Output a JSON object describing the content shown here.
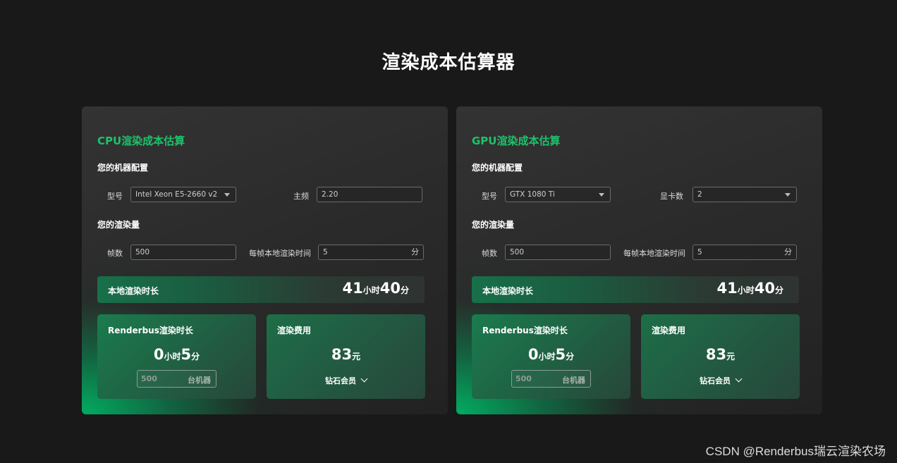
{
  "page": {
    "title": "渲染成本估算器"
  },
  "cards": [
    {
      "title": "CPU渲染成本估算",
      "machine_section": "您的机器配置",
      "field1_label": "型号",
      "field1_value": "Intel Xeon E5-2660 v2",
      "field2_label": "主频",
      "field2_value": "2.20",
      "render_section": "您的渲染量",
      "frames_label": "帧数",
      "frames_value": "500",
      "per_frame_label": "每帧本地渲染时间",
      "per_frame_value": "5",
      "per_frame_unit": "分",
      "local": {
        "label": "本地渲染时长",
        "hours": "41",
        "hours_unit": "小时",
        "minutes": "40",
        "minutes_unit": "分"
      },
      "renderbus": {
        "label": "Renderbus渲染时长",
        "hours": "0",
        "hours_unit": "小时",
        "minutes": "5",
        "minutes_unit": "分",
        "machines": "500",
        "machines_unit": "台机器"
      },
      "fee": {
        "label": "渲染费用",
        "amount": "83",
        "amount_unit": "元",
        "member": "钻石会员"
      }
    },
    {
      "title": "GPU渲染成本估算",
      "machine_section": "您的机器配置",
      "field1_label": "型号",
      "field1_value": "GTX 1080 Ti",
      "field2_label": "显卡数",
      "field2_value": "2",
      "render_section": "您的渲染量",
      "frames_label": "帧数",
      "frames_value": "500",
      "per_frame_label": "每帧本地渲染时间",
      "per_frame_value": "5",
      "per_frame_unit": "分",
      "local": {
        "label": "本地渲染时长",
        "hours": "41",
        "hours_unit": "小时",
        "minutes": "40",
        "minutes_unit": "分"
      },
      "renderbus": {
        "label": "Renderbus渲染时长",
        "hours": "0",
        "hours_unit": "小时",
        "minutes": "5",
        "minutes_unit": "分",
        "machines": "500",
        "machines_unit": "台机器"
      },
      "fee": {
        "label": "渲染费用",
        "amount": "83",
        "amount_unit": "元",
        "member": "钻石会员"
      }
    }
  ],
  "watermark": "CSDN @Renderbus瑞云渲染农场",
  "colors": {
    "accent": "#1ec26a",
    "background": "#191919"
  }
}
